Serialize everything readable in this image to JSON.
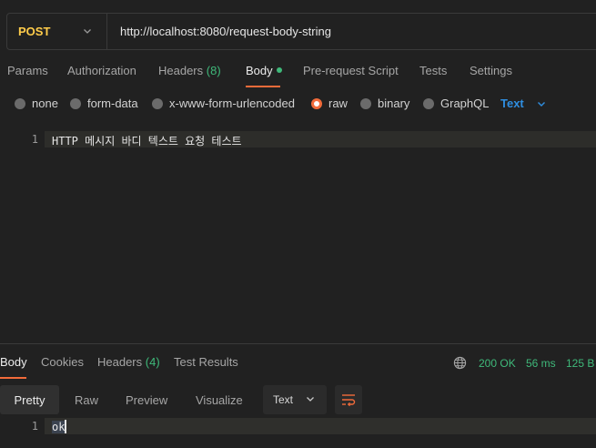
{
  "request": {
    "method": "POST",
    "url": "http://localhost:8080/request-body-string"
  },
  "request_tabs": [
    {
      "label": "Params"
    },
    {
      "label": "Authorization"
    },
    {
      "label": "Headers",
      "count": "(8)"
    },
    {
      "label": "Body"
    },
    {
      "label": "Pre-request Script"
    },
    {
      "label": "Tests"
    },
    {
      "label": "Settings"
    }
  ],
  "body_types": [
    {
      "label": "none"
    },
    {
      "label": "form-data"
    },
    {
      "label": "x-www-form-urlencoded"
    },
    {
      "label": "raw"
    },
    {
      "label": "binary"
    },
    {
      "label": "GraphQL"
    }
  ],
  "raw_format": "Text",
  "editor": {
    "line_number": "1",
    "line": "HTTP 메시지 바디 텍스트 요청 테스트"
  },
  "response_tabs": [
    {
      "label": "Body"
    },
    {
      "label": "Cookies"
    },
    {
      "label": "Headers",
      "count": "(4)"
    },
    {
      "label": "Test Results"
    }
  ],
  "response_status": {
    "status": "200 OK",
    "time": "56 ms",
    "size": "125 B"
  },
  "view_modes": [
    {
      "label": "Pretty"
    },
    {
      "label": "Raw"
    },
    {
      "label": "Preview"
    },
    {
      "label": "Visualize"
    }
  ],
  "response_format": "Text",
  "response_body": {
    "line_number": "1",
    "line": "ok"
  },
  "colors": {
    "accent": "#f26b3a",
    "method": "#ffcc4a",
    "status": "#3fb97a",
    "link": "#2f8ee0"
  }
}
